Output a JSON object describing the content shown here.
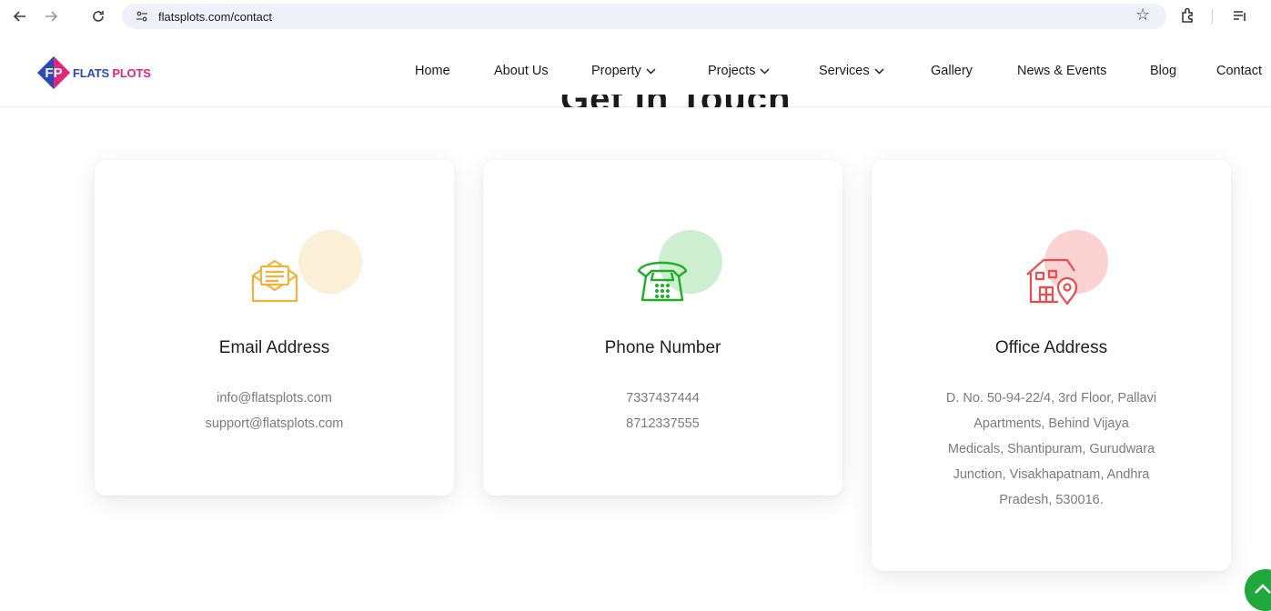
{
  "browser": {
    "url": "flatsplots.com/contact"
  },
  "header": {
    "logo": {
      "initials": "FP",
      "word1": "FLATS",
      "word2": "PLOTS"
    },
    "nav": [
      {
        "label": "Home",
        "has_dropdown": false
      },
      {
        "label": "About Us",
        "has_dropdown": false
      },
      {
        "label": "Property",
        "has_dropdown": true
      },
      {
        "label": "Projects",
        "has_dropdown": true
      },
      {
        "label": "Services",
        "has_dropdown": true
      },
      {
        "label": "Gallery",
        "has_dropdown": false
      },
      {
        "label": "News & Events",
        "has_dropdown": false
      },
      {
        "label": "Blog",
        "has_dropdown": false
      },
      {
        "label": "Contact",
        "has_dropdown": false
      }
    ]
  },
  "section": {
    "heading": "Get In Touch"
  },
  "cards": [
    {
      "icon": "envelope-icon",
      "accent": "#f0b23a",
      "blob": "#fbefd8",
      "title": "Email Address",
      "lines": [
        "info@flatsplots.com",
        "support@flatsplots.com"
      ]
    },
    {
      "icon": "telephone-icon",
      "accent": "#1fae2a",
      "blob": "#cdeecf",
      "title": "Phone Number",
      "lines": [
        "7337437444",
        "8712337555"
      ]
    },
    {
      "icon": "office-location-icon",
      "accent": "#ee4c4c",
      "blob": "#fbd2d2",
      "title": "Office Address",
      "lines": [
        "D. No. 50-94-22/4, 3rd Floor, Pallavi",
        "Apartments, Behind Vijaya",
        "Medicals, Shantipuram, Gurudwara",
        "Junction, Visakhapatnam, Andhra",
        "Pradesh, 530016."
      ]
    }
  ],
  "colors": {
    "brand_blue": "#2b4ab8",
    "brand_pink": "#e0267e",
    "scroll_top": "#1fa83b"
  }
}
